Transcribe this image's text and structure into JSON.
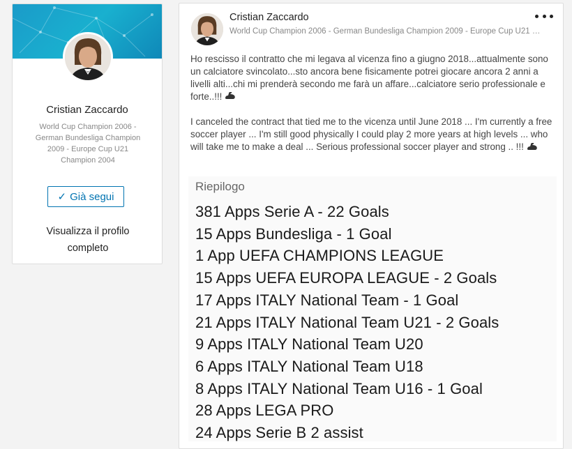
{
  "profile": {
    "name": "Cristian Zaccardo",
    "headline": "World Cup Champion 2006 - German Bundesliga Champion 2009 - Europe Cup U21 Champion 2004",
    "follow_label": "Già segui",
    "view_profile_label": "Visualizza il profilo completo",
    "accent_color": "#0073b1"
  },
  "post": {
    "author": "Cristian Zaccardo",
    "headline": "World Cup Champion 2006 - German Bundesliga Champion 2009 - Europe Cup U21 …",
    "menu_icon": "more-horizontal-icon",
    "text_it": "Ho rescisso il contratto che mi legava al vicenza fino a giugno 2018...attualmente sono un calciatore svincolato...sto ancora bene fisicamente potrei giocare ancora 2 anni a livelli alti...chi mi prenderà secondo me farà un affare...calciatore serio professionale e forte..!!!",
    "text_en": "I canceled the contract that tied me to the vicenza until June 2018 ... I'm currently a free soccer player ... I'm still good physically I could play 2 more years at high levels ... who will take me to make a deal ... Serious professional soccer player and strong .. !!!",
    "emoji_icon": "flexed-biceps-icon"
  },
  "summary_image": {
    "title": "Riepilogo",
    "stats": [
      "381 Apps Serie A -  22 Goals",
      "15 Apps Bundesliga - 1 Goal",
      "1 App UEFA CHAMPIONS LEAGUE",
      "15 Apps UEFA EUROPA LEAGUE - 2 Goals",
      "17 Apps ITALY National Team - 1 Goal",
      "21 Apps ITALY National Team U21 - 2 Goals",
      "9 Apps ITALY National Team U20",
      "6 Apps ITALY National Team U18",
      "8 Apps ITALY National Team U16 - 1 Goal",
      "28 Apps LEGA PRO",
      "24 Apps Serie B 2 assist"
    ]
  }
}
